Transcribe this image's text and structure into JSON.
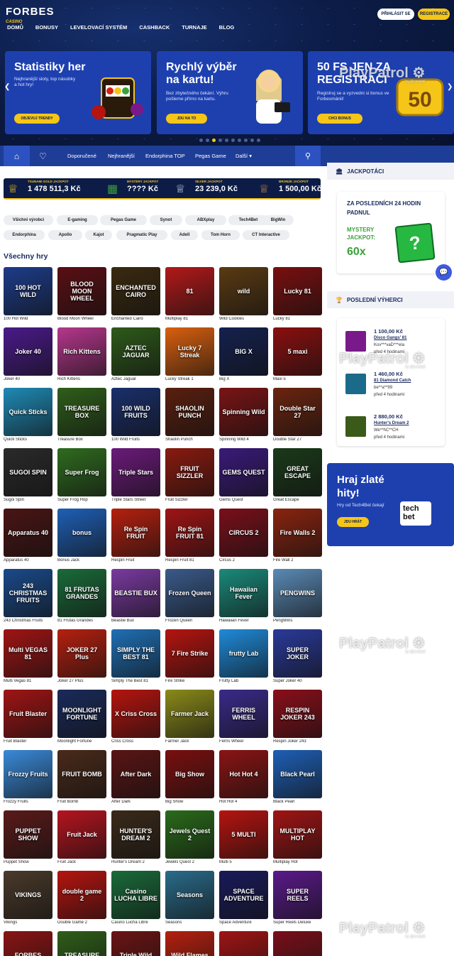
{
  "header": {
    "logo": "FORBES",
    "logo_sub": "CASINO",
    "login_label": "PŘIHLÁSIT SE",
    "register_label": "REGISTRACE",
    "nav": [
      "DOMŮ",
      "BONUSY",
      "LEVELOVACÍ SYSTÉM",
      "CASHBACK",
      "TURNAJE",
      "BLOG"
    ]
  },
  "banners": [
    {
      "title": "Statistiky her",
      "subtitle": "Nejhranější sloty, top násobky a hot hry!",
      "button": "OBJEVUJ TRENDY"
    },
    {
      "title": "Rychlý výběr na kartu!",
      "subtitle": "Bez zbytečného čekání. Výhru pošleme přímo na kartu.",
      "button": "JDU NA TO"
    },
    {
      "title": "50 FS JEN ZA REGISTRACI",
      "subtitle": "Registruj se a vyzvedni si bonus ve Forbesmánii!",
      "button": "CHCI BONUS",
      "badge": "50"
    }
  ],
  "carousel": {
    "count": 10,
    "active": 3
  },
  "subnav": {
    "links": [
      "Doporučené",
      "Nejhranější",
      "Endorphina TOP",
      "Pegas Game",
      "Další"
    ]
  },
  "jackpots": [
    {
      "name": "TSUNAMI GOLD JACKPOT",
      "value": "1 478 511,3 Kč"
    },
    {
      "name": "MYSTERY JACKPOT",
      "value": "???? Kč"
    },
    {
      "name": "SILVER JACKPOT",
      "value": "23 239,0 Kč"
    },
    {
      "name": "BRONZE JACKPOT",
      "value": "1 500,00 Kč"
    }
  ],
  "providers": [
    "Všichni výrobci",
    "E-gaming",
    "Pegas Game",
    "Synot",
    "ABXplay",
    "Tech4Bet",
    "BigWin",
    "Endorphina",
    "Apollo",
    "Kajot",
    "Pragmatic Play",
    "Adell",
    "Tom Horn",
    "CT Interactive"
  ],
  "section_title": "Všechny hry",
  "games": [
    {
      "name": "100 Hot Wild",
      "art": "100 HOT WILD",
      "bg": "#1d3c8a"
    },
    {
      "name": "Blood Moon Wheel",
      "art": "BLOOD MOON WHEEL",
      "bg": "#5a0f14"
    },
    {
      "name": "Enchanted Cairo",
      "art": "ENCHANTED CAIRO",
      "bg": "#3a2a10"
    },
    {
      "name": "Multiplay 81",
      "art": "81",
      "bg": "#b31919"
    },
    {
      "name": "Wild Cookies",
      "art": "wild",
      "bg": "#5a3a12"
    },
    {
      "name": "Lucky 81",
      "art": "Lucky 81",
      "bg": "#7a0f0f"
    },
    {
      "name": "Joker 40",
      "art": "Joker 40",
      "bg": "#4a1a8a"
    },
    {
      "name": "Rich Kittens",
      "art": "Rich Kittens",
      "bg": "#b5378c"
    },
    {
      "name": "Aztec Jaguar",
      "art": "AZTEC JAGUAR",
      "bg": "#2e5a1a"
    },
    {
      "name": "Lucky Streak 1",
      "art": "Lucky 7 Streak",
      "bg": "#d9600f"
    },
    {
      "name": "Big X",
      "art": "BIG X",
      "bg": "#14214f"
    },
    {
      "name": "Maxi 5",
      "art": "5 maxi",
      "bg": "#8a0f0f"
    },
    {
      "name": "Quick Sticks",
      "art": "Quick Sticks",
      "bg": "#1f8ab5"
    },
    {
      "name": "Treasure Box",
      "art": "TREASURE BOX",
      "bg": "#2f5e1a"
    },
    {
      "name": "100 Wild Fruits",
      "art": "100 WILD FRUITS",
      "bg": "#1a2f6b"
    },
    {
      "name": "Shaolin Punch",
      "art": "SHAOLIN PUNCH",
      "bg": "#5a1f0f"
    },
    {
      "name": "Spinning Wild 4",
      "art": "Spinning Wild",
      "bg": "#7a1414"
    },
    {
      "name": "Double Star 27",
      "art": "Double Star 27",
      "bg": "#6b240f"
    },
    {
      "name": "Sugoi Spin",
      "art": "SUGOI SPIN",
      "bg": "#2a2a2a"
    },
    {
      "name": "Super Frog Hop",
      "art": "Super Frog",
      "bg": "#2f6b1f"
    },
    {
      "name": "Triple Stars Street",
      "art": "Triple Stars",
      "bg": "#6b1a7a"
    },
    {
      "name": "Fruit Sizzler",
      "art": "FRUIT SIZZLER",
      "bg": "#8a1a0f"
    },
    {
      "name": "Gems Quest",
      "art": "GEMS QUEST",
      "bg": "#3a1a7a"
    },
    {
      "name": "Great Escape",
      "art": "GREAT ESCAPE",
      "bg": "#1a3a1a"
    },
    {
      "name": "Apparatus 40",
      "art": "Apparatus 40",
      "bg": "#4a1414"
    },
    {
      "name": "Bonus Jack",
      "art": "bonus",
      "bg": "#1f5fb5"
    },
    {
      "name": "Respin Fruit",
      "art": "Re Spin FRUIT",
      "bg": "#b5200f"
    },
    {
      "name": "Respin Fruit 81",
      "art": "Re Spin FRUIT 81",
      "bg": "#a01414"
    },
    {
      "name": "Circus 2",
      "art": "CIRCUS 2",
      "bg": "#7a0f1a"
    },
    {
      "name": "Fire Wall 2",
      "art": "Fire Walls 2",
      "bg": "#8a240f"
    },
    {
      "name": "243 Christmas Fruits",
      "art": "243 CHRISTMAS FRUITS",
      "bg": "#1a4a8a"
    },
    {
      "name": "81 Frutas Grandes",
      "art": "81 FRUTAS GRANDES",
      "bg": "#1a6b3a"
    },
    {
      "name": "Beastie Bux",
      "art": "BEASTIE BUX",
      "bg": "#7a3aa0"
    },
    {
      "name": "Frozen Queen",
      "art": "Frozen Queen",
      "bg": "#3a5a8a"
    },
    {
      "name": "Hawaiian Fever",
      "art": "Hawaiian Fever",
      "bg": "#1a8a7a"
    },
    {
      "name": "PengWins",
      "art": "PENGWINS",
      "bg": "#5a8ab5"
    },
    {
      "name": "Multi Vegas 81",
      "art": "Multi VEGAS 81",
      "bg": "#a01414"
    },
    {
      "name": "Joker 27 Plus",
      "art": "JOKER 27 Plus",
      "bg": "#b5200f"
    },
    {
      "name": "Simply The Best 81",
      "art": "SIMPLY THE BEST 81",
      "bg": "#1f6fb5"
    },
    {
      "name": "Fire Strike",
      "art": "7 Fire Strike",
      "bg": "#b5140f"
    },
    {
      "name": "Frutty Lab",
      "art": "frutty Lab",
      "bg": "#1f8ad9"
    },
    {
      "name": "Super Joker 40",
      "art": "SUPER JOKER",
      "bg": "#2a3a9a"
    },
    {
      "name": "Fruit Blaster",
      "art": "Fruit Blaster",
      "bg": "#a01414"
    },
    {
      "name": "Moonlight Fortune",
      "art": "MOONLIGHT FORTUNE",
      "bg": "#1a2a5a"
    },
    {
      "name": "Criss Cross",
      "art": "X Criss Cross",
      "bg": "#b5140f"
    },
    {
      "name": "Farmer Jack",
      "art": "Farmer Jack",
      "bg": "#8a8a1a"
    },
    {
      "name": "Ferris Wheel",
      "art": "FERRIS WHEEL",
      "bg": "#3a2a8a"
    },
    {
      "name": "Respin Joker 243",
      "art": "RESPIN JOKER 243",
      "bg": "#8a0f1a"
    },
    {
      "name": "Frozzy Fruits",
      "art": "Frozzy Fruits",
      "bg": "#3a8ad9"
    },
    {
      "name": "Fruit Bomb",
      "art": "FRUIT BOMB",
      "bg": "#4a2a1a"
    },
    {
      "name": "After Dark",
      "art": "After Dark",
      "bg": "#5a1414"
    },
    {
      "name": "Big Show",
      "art": "Big Show",
      "bg": "#7a0f0f"
    },
    {
      "name": "Hot Hot 4",
      "art": "Hot Hot 4",
      "bg": "#8a1414"
    },
    {
      "name": "Black Pearl",
      "art": "Black Pearl",
      "bg": "#1f5fb5"
    },
    {
      "name": "Puppet Show",
      "art": "PUPPET SHOW",
      "bg": "#5a1a1a"
    },
    {
      "name": "Fruit Jack",
      "art": "Fruit Jack",
      "bg": "#b5141f"
    },
    {
      "name": "Hunter's Dream 2",
      "art": "HUNTER'S DREAM 2",
      "bg": "#3a2a1a"
    },
    {
      "name": "Jewels Quest 2",
      "art": "Jewels Quest 2",
      "bg": "#2a6b1a"
    },
    {
      "name": "Multi 5",
      "art": "5 MULTI",
      "bg": "#b5140f"
    },
    {
      "name": "Multiplay Hot",
      "art": "MULTIPLAY HOT",
      "bg": "#a01414"
    },
    {
      "name": "Vikings",
      "art": "VIKINGS",
      "bg": "#4a3a2a"
    },
    {
      "name": "Double Game 2",
      "art": "double game 2",
      "bg": "#b5140f"
    },
    {
      "name": "Casino Lucha Libre",
      "art": "Casino LUCHA LIBRE",
      "bg": "#1a6b3a"
    },
    {
      "name": "Seasons",
      "art": "Seasons",
      "bg": "#2a6b8a"
    },
    {
      "name": "Space Adventure",
      "art": "SPACE ADVENTURE",
      "bg": "#1a1a5a"
    },
    {
      "name": "Super Reels Deluxe",
      "art": "SUPER REELS",
      "bg": "#5a1a8a"
    },
    {
      "name": "",
      "art": "FORBES",
      "bg": "#8a1414"
    },
    {
      "name": "",
      "art": "TREASURE",
      "bg": "#2f5e1a"
    },
    {
      "name": "",
      "art": "Triple Wild",
      "bg": "#6b1414"
    },
    {
      "name": "",
      "art": "Wild Flames",
      "bg": "#b5200f"
    },
    {
      "name": "",
      "art": "",
      "bg": "#a01414"
    },
    {
      "name": "",
      "art": "",
      "bg": "#7a0f1a"
    }
  ],
  "sidebar": {
    "jackpots_title": "JACKPOTÁCI",
    "jackpot_card": {
      "title": "ZA POSLEDNÍCH 24 HODIN PADNUL",
      "label": "MYSTERY JACKPOT:",
      "multiplier": "60x"
    },
    "winners_title": "POSLEDNÍ VÝHERCI",
    "winners": [
      {
        "amount": "1 100,00 Kč",
        "game": "Disco Gangs' 81",
        "user": "Kov***vaD***ela",
        "time": "před 4 hodinami",
        "color": "#7a1a8a"
      },
      {
        "amount": "1 460,00 Kč",
        "game": "81 Diamond Catch",
        "user": "be**a**99",
        "time": "před 4 hodinami",
        "color": "#1a6b8a"
      },
      {
        "amount": "2 880,00 Kč",
        "game": "Hunter's Dream 2",
        "user": "We**hC**CH",
        "time": "před 4 hodinami",
        "color": "#3a5a1a"
      }
    ],
    "promo": {
      "title": "Hraj zlaté hity!",
      "subtitle": "Hry od Tech4Bet čekají",
      "button": "JDU HRÁT",
      "logo": "tech bet"
    }
  },
  "watermark": {
    "brand": "PlayPatrol",
    "by": "by @creatall"
  },
  "colors": {
    "navy": "#0c1c47",
    "blue": "#1e40af",
    "gold": "#f5c518",
    "green": "#3aa13a"
  }
}
